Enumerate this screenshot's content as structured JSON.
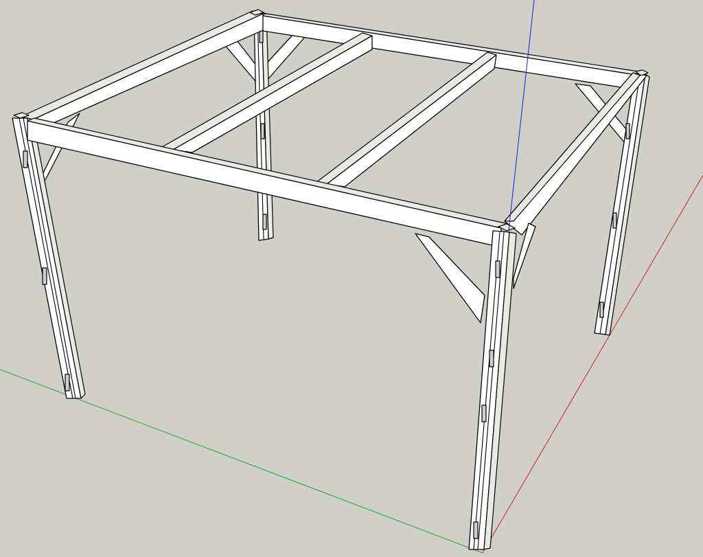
{
  "viewport": {
    "background": "#d0d0c9",
    "model_fill": "#ffffff",
    "edge_color": "#000000",
    "axes": {
      "red": "#d02020",
      "green": "#1fa81f",
      "blue": "#1818d8"
    }
  }
}
